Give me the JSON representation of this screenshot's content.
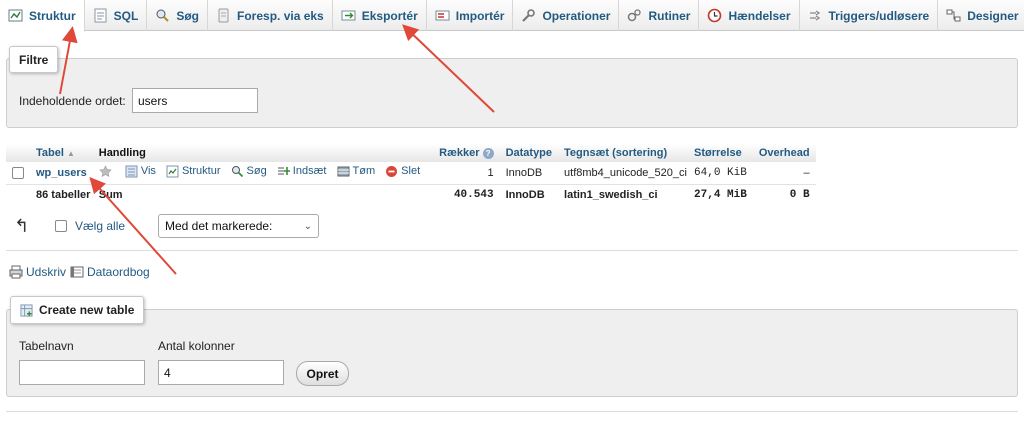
{
  "tabs": [
    {
      "label": "Struktur",
      "icon": "structure-icon",
      "active": true
    },
    {
      "label": "SQL",
      "icon": "sql-icon"
    },
    {
      "label": "Søg",
      "icon": "search-icon"
    },
    {
      "label": "Foresp. via eks",
      "icon": "query-icon"
    },
    {
      "label": "Eksportér",
      "icon": "export-icon"
    },
    {
      "label": "Importér",
      "icon": "import-icon"
    },
    {
      "label": "Operationer",
      "icon": "wrench-icon"
    },
    {
      "label": "Rutiner",
      "icon": "routines-icon"
    },
    {
      "label": "Hændelser",
      "icon": "events-clock-icon"
    },
    {
      "label": "Triggers/udløsere",
      "icon": "triggers-icon"
    },
    {
      "label": "Designer",
      "icon": "designer-icon"
    }
  ],
  "filter": {
    "legend": "Filtre",
    "label": "Indeholdende ordet:",
    "value": "users"
  },
  "table": {
    "headers": {
      "table": "Tabel",
      "action": "Handling",
      "rows": "Rækker",
      "type": "Datatype",
      "collation": "Tegnsæt (sortering)",
      "size": "Størrelse",
      "overhead": "Overhead"
    },
    "row": {
      "name": "wp_users",
      "actions": [
        "Vis",
        "Struktur",
        "Søg",
        "Indsæt",
        "Tøm",
        "Slet"
      ],
      "rows": "1",
      "type": "InnoDB",
      "collation": "utf8mb4_unicode_520_ci",
      "size": "64,0 KiB",
      "overhead": "–"
    },
    "sum": {
      "tables": "86 tabeller",
      "label": "Sum",
      "rows": "40.543",
      "type": "InnoDB",
      "collation": "latin1_swedish_ci",
      "size": "27,4 MiB",
      "overhead": "0 B"
    }
  },
  "bulk": {
    "check_all": "Vælg alle",
    "with_selected": "Med det markerede:"
  },
  "links": {
    "print": "Udskriv",
    "dictionary": "Dataordbog"
  },
  "create": {
    "legend": "Create new table",
    "name_label": "Tabelnavn",
    "name_value": "",
    "cols_label": "Antal kolonner",
    "cols_value": "4",
    "button": "Opret"
  },
  "colors": {
    "link": "#235a81",
    "arrow": "#e0483a",
    "panel": "#efefef"
  }
}
